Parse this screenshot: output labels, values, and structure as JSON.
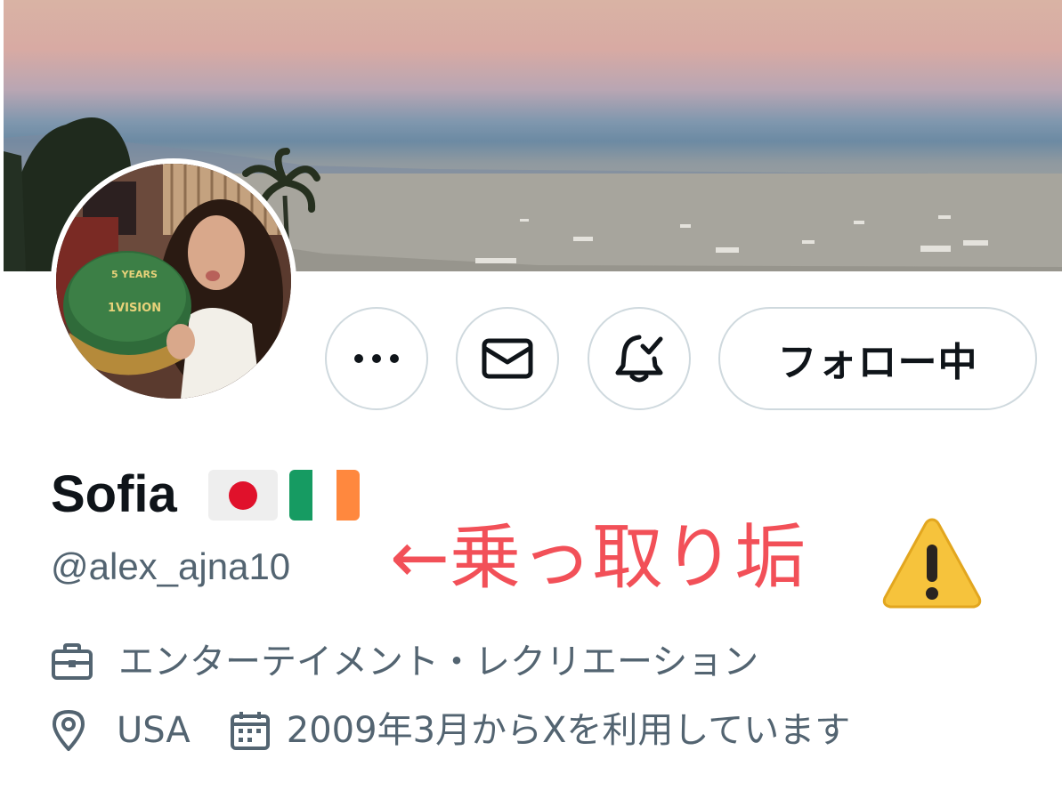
{
  "profile": {
    "name": "Sofia",
    "handle": "@alex_ajna10",
    "flags": [
      "japan-flag",
      "ireland-flag"
    ],
    "category": "エンターテイメント・レクリエーション",
    "location": "USA",
    "joined": "2009年3月からXを利用しています"
  },
  "actions": {
    "more_icon": "more-icon",
    "message_icon": "mail-icon",
    "notify_icon": "bell-check-icon",
    "follow_label": "フォロー中"
  },
  "annotation": {
    "text": "←乗っ取り垢",
    "icon": "warning-icon",
    "color": "#f25058"
  },
  "colors": {
    "text_primary": "#0f1419",
    "text_secondary": "#536471",
    "border": "#cfd9de"
  }
}
